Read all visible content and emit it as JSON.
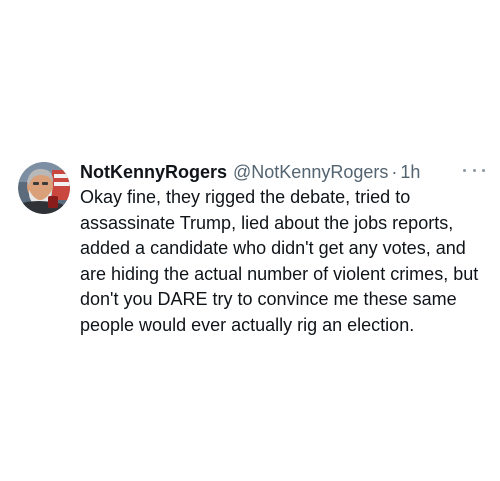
{
  "tweet": {
    "display_name": "NotKennyRogers",
    "handle": "@NotKennyRogers",
    "separator": "·",
    "time": "1h",
    "avatar_icon": "user-avatar-icon",
    "more_icon": "more-dots-icon",
    "text": "Okay fine, they rigged the debate, tried to assassinate Trump, lied about the jobs reports, added a candidate who didn't get any votes, and are hiding the actual number of violent crimes, but don't you DARE try to convince me these same people would ever actually rig an election."
  },
  "colors": {
    "text_primary": "#0f1419",
    "text_secondary": "#536471",
    "background": "#ffffff"
  }
}
